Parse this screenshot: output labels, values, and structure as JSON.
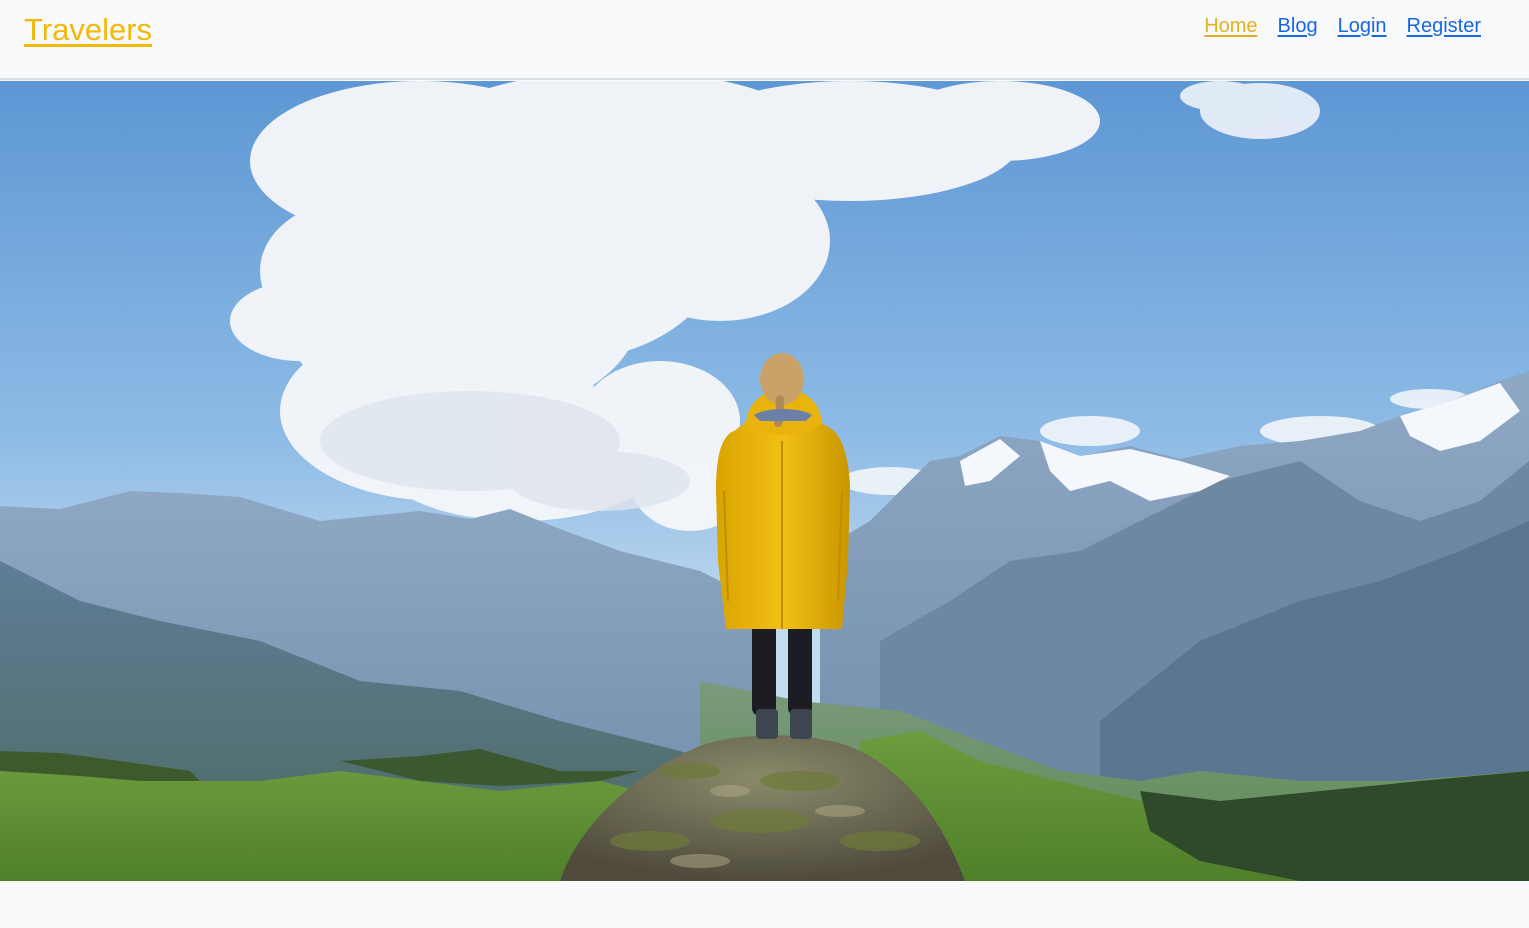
{
  "navbar": {
    "brand": "Travelers",
    "links": [
      {
        "label": "Home",
        "active": true
      },
      {
        "label": "Blog",
        "active": false
      },
      {
        "label": "Login",
        "active": false
      },
      {
        "label": "Register",
        "active": false
      }
    ]
  },
  "colors": {
    "brand": "#f0b90b",
    "active_link": "#e6b022",
    "link": "#1a66e0",
    "background": "#f8f9fa"
  },
  "hero": {
    "image": "photo of a hiker in a yellow raincoat standing on a rock facing a mountain valley under a cloudy blue sky"
  }
}
